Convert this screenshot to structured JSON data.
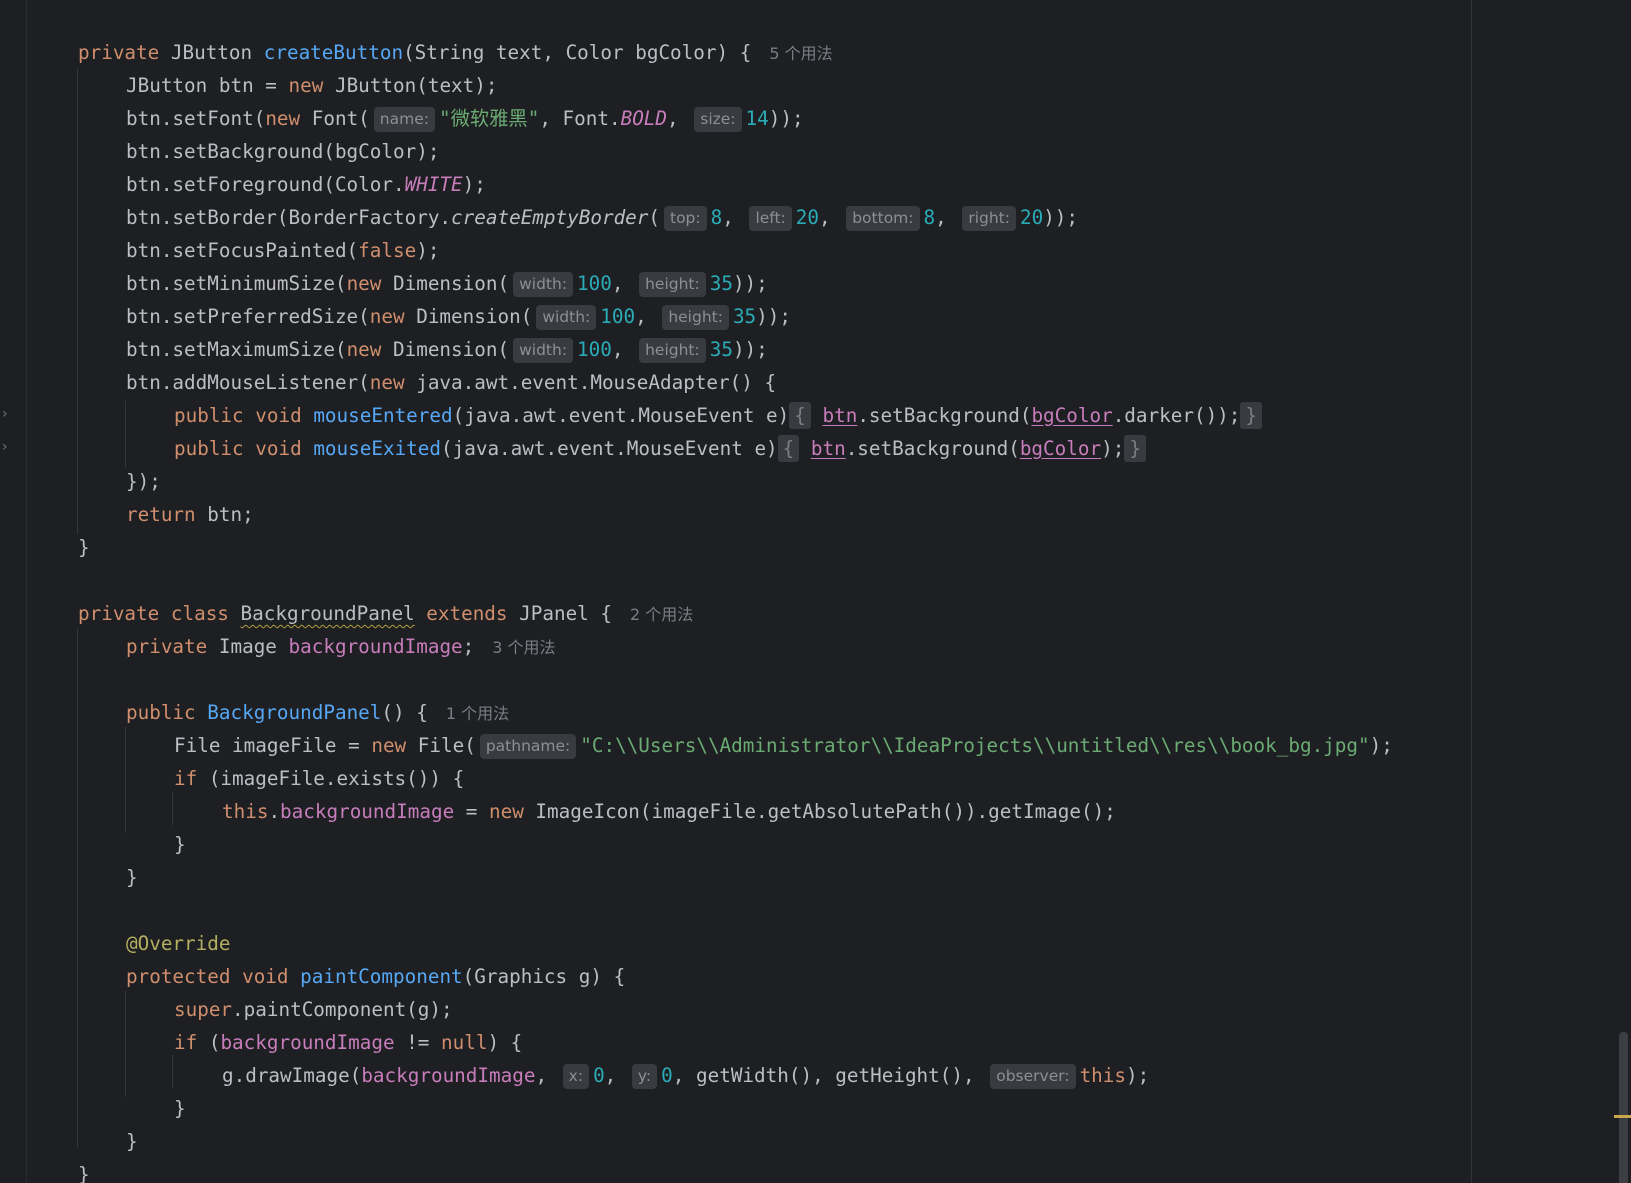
{
  "gutter": {
    "fold_icon": "chevron-right-icon"
  },
  "create_button": {
    "sig": {
      "mods": "private",
      "ret": "JButton",
      "name": "createButton",
      "params": "(String text, Color bgColor) {",
      "usage": "5 个用法"
    },
    "l1": {
      "t1": "JButton btn = ",
      "kw": "new",
      "t2": " JButton(text);"
    },
    "l2": {
      "t1": "btn.setFont(",
      "kw": "new",
      "t2": " Font(",
      "h1": "name:",
      "s": "\"微软雅黑\"",
      "t3": ", Font.",
      "c": "BOLD",
      "t4": ",",
      "h2": "size:",
      "n": "14",
      "t5": "));"
    },
    "l3": {
      "t1": "btn.setBackground(bgColor);"
    },
    "l4": {
      "t1": "btn.setForeground(Color.",
      "c": "WHITE",
      "t2": ");"
    },
    "l5": {
      "t1": "btn.setBorder(BorderFactory.",
      "it": "createEmptyBorder",
      "t2": "(",
      "h1": "top:",
      "n1": "8",
      "h2": "left:",
      "n2": "20",
      "h3": "bottom:",
      "n3": "8",
      "h4": "right:",
      "n4": "20",
      "t3": "));"
    },
    "l6": {
      "t1": "btn.setFocusPainted(",
      "kw": "false",
      "t2": ");"
    },
    "l7": {
      "t1": "btn.setMinimumSize(",
      "kw": "new",
      "t2": " Dimension(",
      "h1": "width:",
      "n1": "100",
      "h2": "height:",
      "n2": "35",
      "t3": "));"
    },
    "l8": {
      "t1": "btn.setPreferredSize(",
      "kw": "new",
      "t2": " Dimension(",
      "h1": "width:",
      "n1": "100",
      "h2": "height:",
      "n2": "35",
      "t3": "));"
    },
    "l9": {
      "t1": "btn.setMaximumSize(",
      "kw": "new",
      "t2": " Dimension(",
      "h1": "width:",
      "n1": "100",
      "h2": "height:",
      "n2": "35",
      "t3": "));"
    },
    "l10": {
      "t1": "btn.addMouseListener(",
      "kw": "new",
      "t2": " java.awt.event.MouseAdapter() {"
    },
    "l11": {
      "kw": "public void",
      "fn": "mouseEntered",
      "t1": "(java.awt.event.MouseEvent e)",
      "ob": "{",
      "v1": "btn",
      "t2": ".setBackground(",
      "v2": "bgColor",
      "t3": ".darker());",
      "cb": "}"
    },
    "l12": {
      "kw": "public void",
      "fn": "mouseExited",
      "t1": "(java.awt.event.MouseEvent e)",
      "ob": "{",
      "v1": "btn",
      "t2": ".setBackground(",
      "v2": "bgColor",
      "t3": ");",
      "cb": "}"
    },
    "l13": {
      "t1": "});"
    },
    "l14": {
      "kw": "return",
      "t1": " btn;"
    },
    "l15": {
      "t1": "}"
    }
  },
  "background_panel": {
    "decl": {
      "kw": "private class",
      "name": "BackgroundPanel",
      "kw2": "extends",
      "t1": " JPanel {",
      "usage": "2 个用法"
    },
    "field": {
      "kw": "private",
      "t1": " Image ",
      "f": "backgroundImage",
      "t2": ";",
      "usage": "3 个用法"
    },
    "ctor": {
      "kw": "public",
      "fn": "BackgroundPanel",
      "t1": "() {",
      "usage": "1 个用法"
    },
    "file": {
      "t1": "File imageFile = ",
      "kw": "new",
      "t2": " File(",
      "h1": "pathname:",
      "s": "\"C:\\\\Users\\\\Administrator\\\\IdeaProjects\\\\untitled\\\\res\\\\book_bg.jpg\"",
      "t3": ");"
    },
    "if1": {
      "kw": "if",
      "t1": " (imageFile.exists()) {"
    },
    "assign": {
      "kw": "this",
      "t1": ".",
      "f": "backgroundImage",
      "t2": " = ",
      "kw2": "new",
      "t3": " ImageIcon(imageFile.getAbsolutePath()).getImage();"
    },
    "close1": {
      "t1": "}"
    },
    "close2": {
      "t1": "}"
    },
    "override": {
      "ann": "@Override"
    },
    "paint": {
      "kw": "protected void",
      "fn": "paintComponent",
      "t1": "(Graphics g) {"
    },
    "super": {
      "kw": "super",
      "t1": ".paintComponent(g);"
    },
    "if2": {
      "kw": "if",
      "t1": " (",
      "f": "backgroundImage",
      "t2": " != ",
      "kw2": "null",
      "t3": ") {"
    },
    "draw": {
      "t1": "g.drawImage(",
      "f": "backgroundImage",
      "t2": ",",
      "h1": "x:",
      "n1": "0",
      "h2": "y:",
      "n2": "0",
      "t3": ", getWidth(), getHeight(),",
      "h3": "observer:",
      "kw": "this",
      "t4": ");"
    },
    "close3": {
      "t1": "}"
    },
    "close4": {
      "t1": "}"
    },
    "close5": {
      "t1": "}"
    }
  }
}
